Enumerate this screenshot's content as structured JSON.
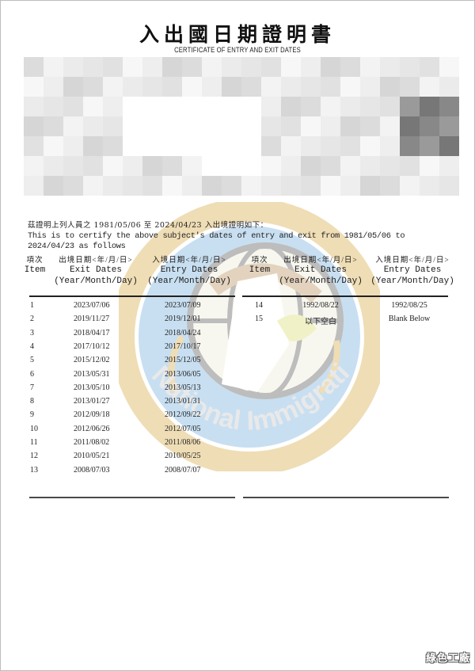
{
  "document": {
    "title": "入出國日期證明書",
    "subtitle": "CERTIFICATE OF ENTRY AND EXIT DATES",
    "redacted_region": "personal-information-blurred",
    "intro_zh": "茲證明上列人員之 1981/05/06 至 2024/04/23 入出境證明如下：",
    "intro_en": "This is to certify the above subject's dates of entry and exit from 1981/05/06 to 2024/04/23 as follows",
    "period_start": "1981/05/06",
    "period_end": "2024/04/23",
    "watermark_text": "National Immigration Agency"
  },
  "table": {
    "headers": {
      "item_zh": "項次",
      "item_en": "Item",
      "exit_zh": "出境日期<年/月/日>",
      "exit_en": "Exit Dates",
      "exit_fmt": "(Year/Month/Day)",
      "entry_zh": "入境日期<年/月/日>",
      "entry_en": "Entry Dates",
      "entry_fmt": "(Year/Month/Day)"
    },
    "left_rows": [
      {
        "item": "1",
        "exit": "2023/07/06",
        "entry": "2023/07/09"
      },
      {
        "item": "2",
        "exit": "2019/11/27",
        "entry": "2019/12/01"
      },
      {
        "item": "3",
        "exit": "2018/04/17",
        "entry": "2018/04/24"
      },
      {
        "item": "4",
        "exit": "2017/10/12",
        "entry": "2017/10/17"
      },
      {
        "item": "5",
        "exit": "2015/12/02",
        "entry": "2015/12/05"
      },
      {
        "item": "6",
        "exit": "2013/05/31",
        "entry": "2013/06/05"
      },
      {
        "item": "7",
        "exit": "2013/05/10",
        "entry": "2013/05/13"
      },
      {
        "item": "8",
        "exit": "2013/01/27",
        "entry": "2013/01/31"
      },
      {
        "item": "9",
        "exit": "2012/09/18",
        "entry": "2012/09/22"
      },
      {
        "item": "10",
        "exit": "2012/06/26",
        "entry": "2012/07/05"
      },
      {
        "item": "11",
        "exit": "2011/08/02",
        "entry": "2011/08/06"
      },
      {
        "item": "12",
        "exit": "2010/05/21",
        "entry": "2010/05/25"
      },
      {
        "item": "13",
        "exit": "2008/07/03",
        "entry": "2008/07/07"
      }
    ],
    "right_rows": [
      {
        "item": "14",
        "exit": "1992/08/22",
        "entry": "1992/08/25"
      },
      {
        "item": "15",
        "exit": "以下空白",
        "entry": "Blank Below"
      }
    ]
  },
  "footer": {
    "watermark_logo": "綠色工廠"
  },
  "colors": {
    "seal_blue": "#9cc6e6",
    "seal_gold": "#e3c27a",
    "seal_tan": "#cdb089",
    "text": "#1a1a1a"
  }
}
